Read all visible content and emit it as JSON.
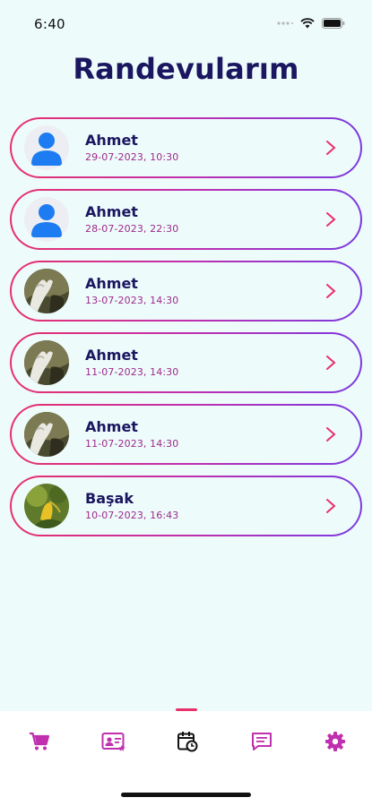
{
  "status_bar": {
    "time": "6:40"
  },
  "page": {
    "title": "Randevularım"
  },
  "appointments": [
    {
      "name": "Ahmet",
      "datetime": "29-07-2023,  10:30",
      "avatar": "default-avatar-icon"
    },
    {
      "name": "Ahmet",
      "datetime": "28-07-2023,  22:30",
      "avatar": "default-avatar-icon"
    },
    {
      "name": "Ahmet",
      "datetime": "13-07-2023,  14:30",
      "avatar": "photo-hands"
    },
    {
      "name": "Ahmet",
      "datetime": "11-07-2023,  14:30",
      "avatar": "photo-hands"
    },
    {
      "name": "Ahmet",
      "datetime": "11-07-2023,  14:30",
      "avatar": "photo-hands"
    },
    {
      "name": "Başak",
      "datetime": "10-07-2023,  16:43",
      "avatar": "photo-plant"
    }
  ],
  "bottom_nav": {
    "active_index": 2,
    "items": [
      "cart-icon",
      "contact-card-icon",
      "appointments-icon",
      "messages-icon",
      "settings-icon"
    ]
  },
  "colors": {
    "accent_pink": "#e8306a",
    "accent_purple": "#7a3ae0",
    "title_navy": "#1a1660",
    "date_magenta": "#9c2a8a",
    "background": "#eefbfb"
  }
}
